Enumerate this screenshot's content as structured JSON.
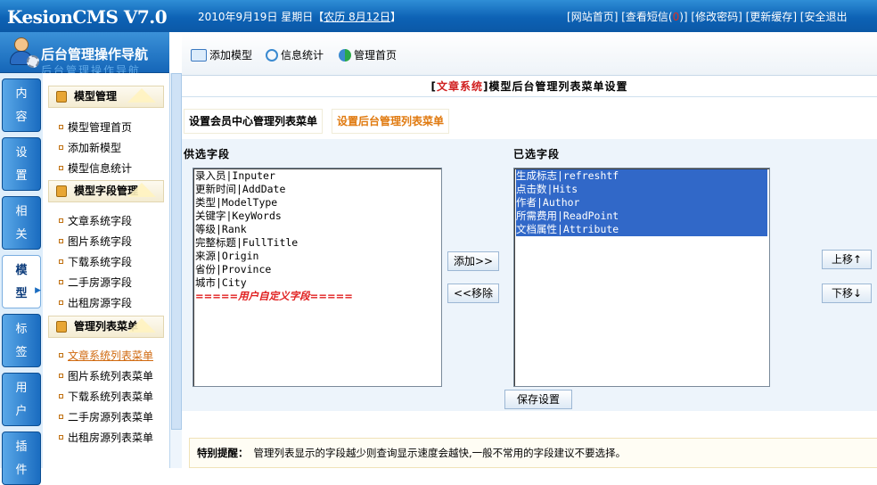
{
  "app": {
    "title": "KesionCMS V7.0"
  },
  "header": {
    "date_text": "2010年9月19日 星期日",
    "lunar": "农历 8月12日",
    "links": [
      "网站首页",
      "查看短信",
      "修改密码",
      "更新缓存",
      "安全退出"
    ],
    "message_count": "0"
  },
  "sidebar": {
    "title": "后台管理操作导航",
    "title_ghost": "后台管理操作导航",
    "tabs": [
      "内容",
      "设置",
      "相关",
      "模型",
      "标签",
      "用户",
      "插件"
    ],
    "active_tab": "模型",
    "groups": [
      {
        "title": "模型管理",
        "items": [
          "模型管理首页",
          "添加新模型",
          "模型信息统计"
        ]
      },
      {
        "title": "模型字段管理",
        "items": [
          "文章系统字段",
          "图片系统字段",
          "下载系统字段",
          "二手房源字段",
          "出租房源字段"
        ]
      },
      {
        "title": "管理列表菜单",
        "items": [
          "文章系统列表菜单",
          "图片系统列表菜单",
          "下载系统列表菜单",
          "二手房源列表菜单",
          "出租房源列表菜单"
        ]
      }
    ],
    "active_item": "文章系统列表菜单"
  },
  "toolbar": {
    "add_model": "添加模型",
    "info_stats": "信息统计",
    "admin_home": "管理首页"
  },
  "page": {
    "module": "文章系统",
    "heading": "模型后台管理列表菜单设置"
  },
  "tabs": {
    "member_center": "设置会员中心管理列表菜单",
    "backend": "设置后台管理列表菜单"
  },
  "form": {
    "available_label": "供选字段",
    "selected_label": "已选字段",
    "available_fields": [
      "录入员|Inputer",
      "更新时间|AddDate",
      "类型|ModelType",
      "关键字|KeyWords",
      "等级|Rank",
      "完整标题|FullTitle",
      "来源|Origin",
      "省份|Province",
      "城市|City"
    ],
    "custom_separator": "=====用户自定义字段=====",
    "selected_fields": [
      "生成标志|refreshtf",
      "点击数|Hits",
      "作者|Author",
      "所需费用|ReadPoint",
      "文档属性|Attribute"
    ],
    "add_button": "添加>>",
    "remove_button": "<<移除",
    "up_button": "上移↑",
    "down_button": "下移↓",
    "save_button": "保存设置"
  },
  "notice": {
    "label": "特别提醒：",
    "text": "管理列表显示的字段越少则查询显示速度会越快,一般不常用的字段建议不要选择。"
  }
}
